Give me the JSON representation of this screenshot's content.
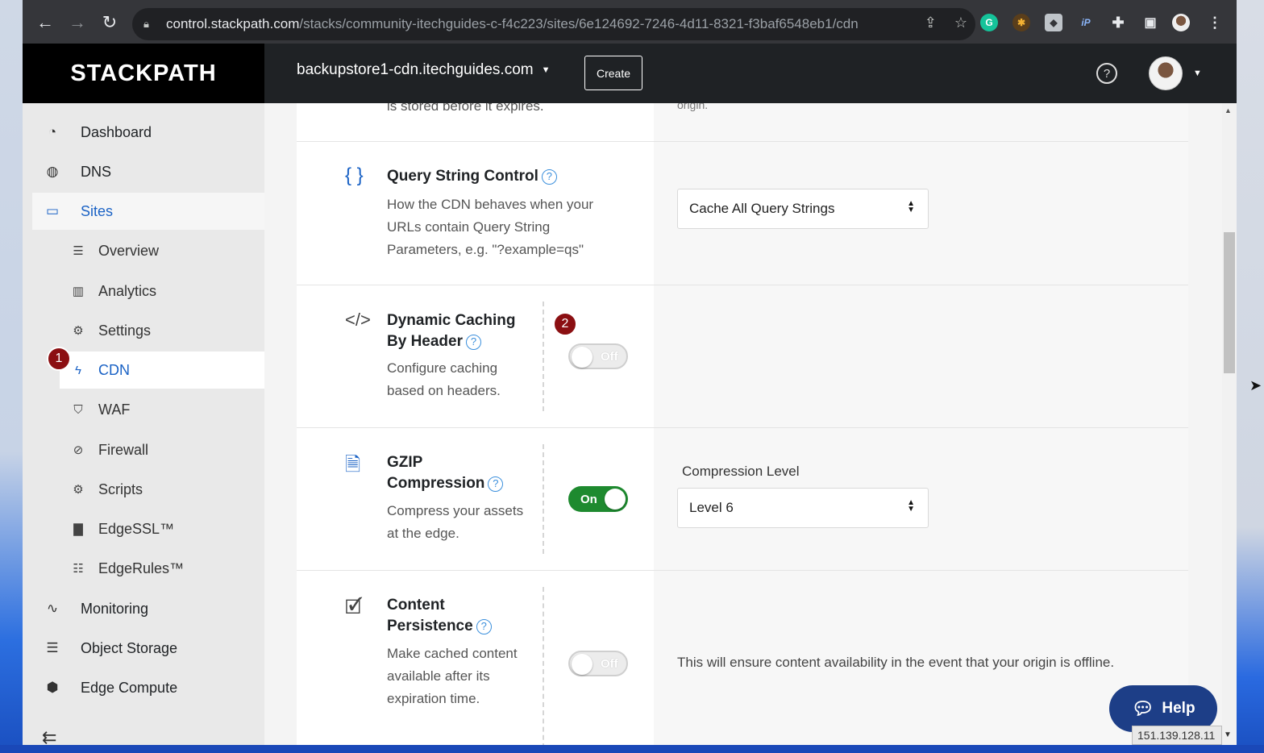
{
  "browser": {
    "url_host": "control.stackpath.com",
    "url_path": "/stacks/community-itechguides-c-f4c223/sites/6e124692-7246-4d11-8321-f3baf6548eb1/cdn",
    "ext_grammarly": "G",
    "ext_ip": "iP"
  },
  "appbar": {
    "logo": "STACKPATH",
    "site": "backupstore1-cdn.itechguides.com",
    "create_label": "Create",
    "help_icon": "?"
  },
  "sidebar": {
    "items": [
      {
        "label": "Dashboard",
        "icon": "dashboard-icon"
      },
      {
        "label": "DNS",
        "icon": "globe-icon"
      },
      {
        "label": "Sites",
        "icon": "browser-window-icon"
      }
    ],
    "sub_items": [
      {
        "label": "Overview",
        "icon": "list-icon"
      },
      {
        "label": "Analytics",
        "icon": "bar-chart-icon"
      },
      {
        "label": "Settings",
        "icon": "gear-icon"
      },
      {
        "label": "CDN",
        "icon": "bolt-icon"
      },
      {
        "label": "WAF",
        "icon": "shield-icon"
      },
      {
        "label": "Firewall",
        "icon": "ban-icon"
      },
      {
        "label": "Scripts",
        "icon": "gears-icon"
      },
      {
        "label": "EdgeSSL™",
        "icon": "lock-icon"
      },
      {
        "label": "EdgeRules™",
        "icon": "sliders-icon"
      }
    ],
    "bottom_items": [
      {
        "label": "Monitoring",
        "icon": "pulse-icon"
      },
      {
        "label": "Object Storage",
        "icon": "database-icon"
      },
      {
        "label": "Edge Compute",
        "icon": "cube-icon"
      }
    ],
    "badge_1": "1"
  },
  "main": {
    "top_fragment_left": "is stored before it expires.",
    "top_fragment_right": "origin.",
    "query_string": {
      "title": "Query String Control",
      "desc": "How the CDN behaves when your URLs contain Query String Parameters, e.g. \"?example=qs\"",
      "select_value": "Cache All Query Strings",
      "icon": "braces-icon"
    },
    "dynamic_caching": {
      "title_line1": "Dynamic Caching",
      "title_line2": "By Header",
      "desc": "Configure caching based on headers.",
      "toggle_label": "Off",
      "enabled": false,
      "badge": "2",
      "icon": "code-icon"
    },
    "gzip": {
      "title_line1": "GZIP",
      "title_line2": "Compression",
      "desc": "Compress your assets at the edge.",
      "toggle_label": "On",
      "enabled": true,
      "level_label": "Compression Level",
      "level_value": "Level 6",
      "icon": "zip-file-icon"
    },
    "persistence": {
      "title_line1": "Content",
      "title_line2": "Persistence",
      "desc": "Make cached content available after its expiration time.",
      "toggle_label": "Off",
      "enabled": false,
      "note": "This will ensure content availability in the event that your origin is offline.",
      "icon": "file-check-icon"
    }
  },
  "help_button": "Help",
  "ip_address": "151.139.128.11",
  "colors": {
    "accent": "#1a62c5",
    "toggle_on": "#1e8a2f",
    "badge": "#8b0f12",
    "help": "#1d3e87"
  }
}
